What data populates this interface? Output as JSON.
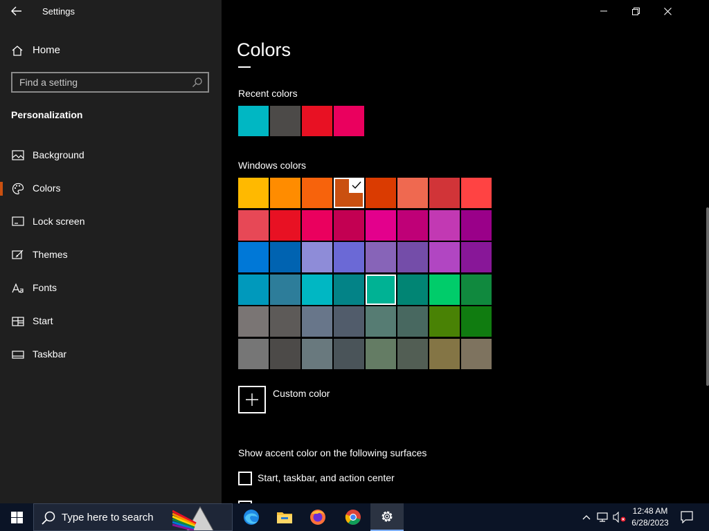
{
  "window": {
    "title": "Settings"
  },
  "sidebar": {
    "home_label": "Home",
    "search_placeholder": "Find a setting",
    "section": "Personalization",
    "items": [
      {
        "label": "Background",
        "icon": "image-icon"
      },
      {
        "label": "Colors",
        "icon": "palette-icon",
        "selected": true
      },
      {
        "label": "Lock screen",
        "icon": "lock-screen-icon"
      },
      {
        "label": "Themes",
        "icon": "themes-icon"
      },
      {
        "label": "Fonts",
        "icon": "fonts-icon"
      },
      {
        "label": "Start",
        "icon": "start-grid-icon"
      },
      {
        "label": "Taskbar",
        "icon": "taskbar-icon"
      }
    ]
  },
  "main": {
    "title": "Colors",
    "recent_label": "Recent colors",
    "recent_colors": [
      "#00b7c3",
      "#4c4a48",
      "#e81123",
      "#ea005e"
    ],
    "windows_label": "Windows colors",
    "windows_colors": [
      [
        "#ffb900",
        "#ff8c00",
        "#f7630c",
        "#ca5010",
        "#da3b01",
        "#ef6950",
        "#d13438",
        "#ff4343"
      ],
      [
        "#e74856",
        "#e81123",
        "#ea005e",
        "#c30052",
        "#e3008c",
        "#bf0077",
        "#c239b3",
        "#9a0089"
      ],
      [
        "#0078d7",
        "#0063b1",
        "#8e8cd8",
        "#6b69d6",
        "#8764b8",
        "#744da9",
        "#b146c2",
        "#881798"
      ],
      [
        "#0099bc",
        "#2d7d9a",
        "#00b7c3",
        "#038387",
        "#00b294",
        "#018574",
        "#00cc6a",
        "#10893e"
      ],
      [
        "#7a7574",
        "#5d5a58",
        "#68768a",
        "#515c6b",
        "#567c73",
        "#486860",
        "#498205",
        "#107c10"
      ],
      [
        "#767676",
        "#4c4a48",
        "#69797e",
        "#4a5459",
        "#647c64",
        "#525e54",
        "#847545",
        "#7e735f"
      ]
    ],
    "selected_color": "#ca5010",
    "hovered_color": "#00b294",
    "custom_color_label": "Custom color",
    "accent_surfaces_label": "Show accent color on the following surfaces",
    "checkbox_start_taskbar": "Start, taskbar, and action center"
  },
  "taskbar": {
    "search_text": "Type here to search",
    "apps": [
      "edge-icon",
      "file-explorer-icon",
      "firefox-icon",
      "chrome-icon",
      "settings-icon"
    ],
    "time": "12:48 AM",
    "date": "6/28/2023"
  }
}
